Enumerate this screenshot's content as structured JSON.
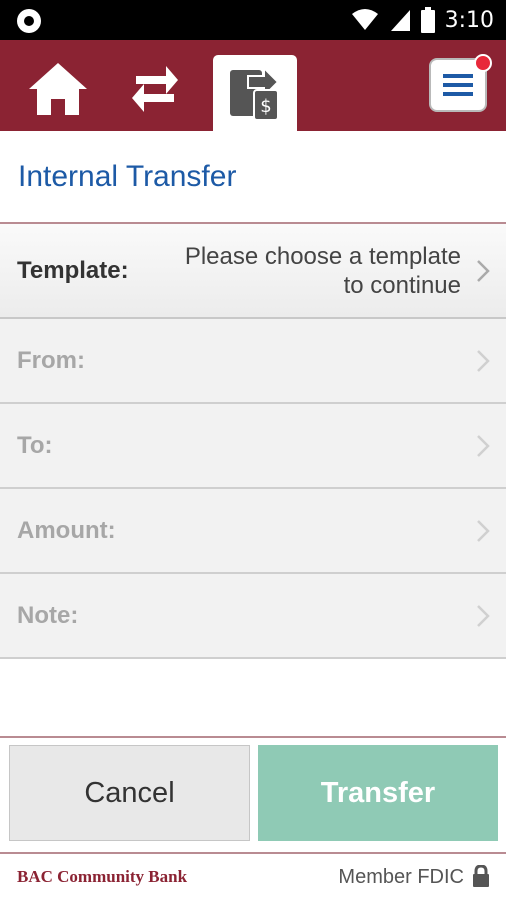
{
  "status_bar": {
    "time": "3:10",
    "icons": [
      "notification-circle-icon",
      "wifi-icon",
      "signal-icon",
      "battery-icon"
    ]
  },
  "nav": {
    "items": [
      {
        "name": "home",
        "icon": "home-icon",
        "active": false
      },
      {
        "name": "transfers",
        "icon": "swap-arrows-icon",
        "active": false
      },
      {
        "name": "transfer-dollar",
        "icon": "transfer-dollar-icon",
        "active": true
      }
    ],
    "menu_icon": "hamburger-menu-icon",
    "menu_has_notification": true,
    "bar_color": "#8b2333"
  },
  "page": {
    "title": "Internal Transfer"
  },
  "form": {
    "template": {
      "label": "Template:",
      "value_line1": "Please choose a template",
      "value_line2": "to continue"
    },
    "rows": [
      {
        "label": "From:"
      },
      {
        "label": "To:"
      },
      {
        "label": "Amount:"
      },
      {
        "label": "Note:"
      }
    ]
  },
  "actions": {
    "cancel_label": "Cancel",
    "transfer_label": "Transfer",
    "transfer_color": "#8fcab5"
  },
  "footer": {
    "bank_name": "BAC Community Bank",
    "fdic": "Member FDIC",
    "lock_icon": "lock-icon"
  },
  "colors": {
    "brand": "#8b2333",
    "title": "#1d5aa6"
  }
}
